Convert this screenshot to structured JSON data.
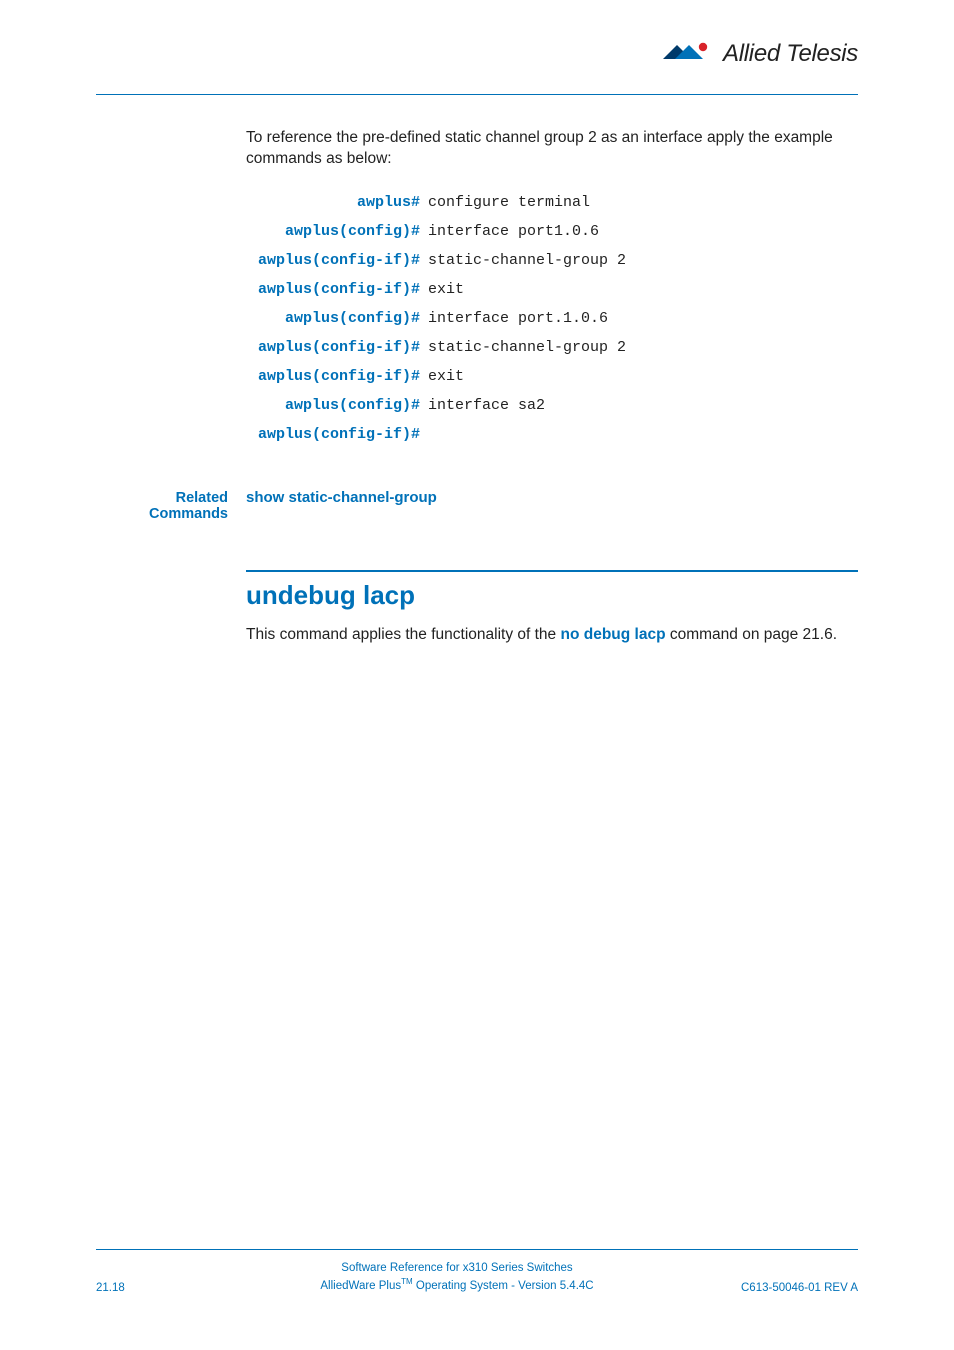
{
  "header": {
    "brand": "Allied Telesis"
  },
  "intro": "To reference the pre-defined static channel group 2 as an interface apply the example commands as below:",
  "cli": [
    {
      "prompt": "awplus#",
      "cmd": "configure terminal"
    },
    {
      "prompt": "awplus(config)#",
      "cmd": "interface port1.0.6"
    },
    {
      "prompt": "awplus(config-if)#",
      "cmd": "static-channel-group 2"
    },
    {
      "prompt": "awplus(config-if)#",
      "cmd": "exit"
    },
    {
      "prompt": "awplus(config)#",
      "cmd": "interface port.1.0.6"
    },
    {
      "prompt": "awplus(config-if)#",
      "cmd": "static-channel-group 2"
    },
    {
      "prompt": "awplus(config-if)#",
      "cmd": "exit"
    },
    {
      "prompt": "awplus(config)#",
      "cmd": "interface sa2"
    },
    {
      "prompt": "awplus(config-if)#",
      "cmd": ""
    }
  ],
  "related": {
    "label": "Related Commands",
    "link": "show static-channel-group"
  },
  "section": {
    "heading": "undebug lacp",
    "body_pre": "This command applies the functionality of the ",
    "body_link": "no debug lacp",
    "body_post": " command on page 21.6."
  },
  "footer": {
    "page": "21.18",
    "line1": "Software Reference for x310 Series Switches",
    "line2_pre": "AlliedWare Plus",
    "line2_tm": "TM",
    "line2_post": " Operating System  - Version 5.4.4C",
    "doc": "C613-50046-01 REV A"
  }
}
